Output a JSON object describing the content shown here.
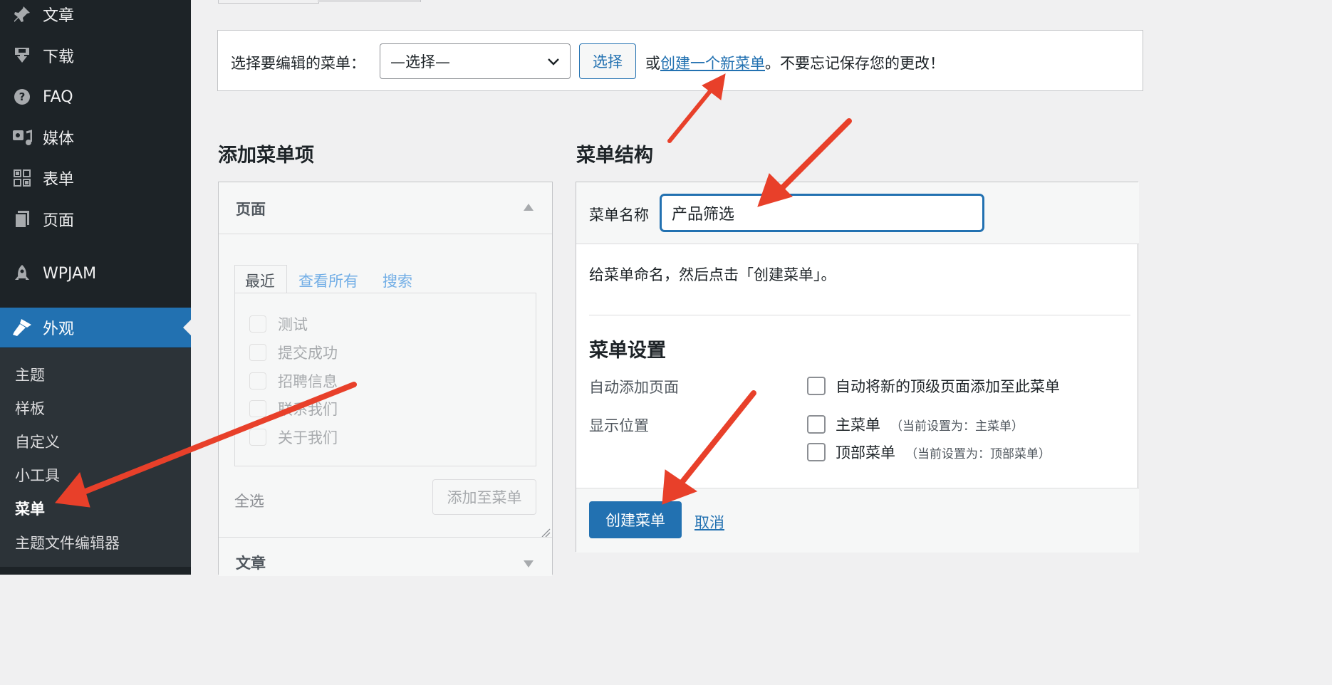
{
  "sidebar": {
    "items": [
      {
        "label": "文章",
        "icon": "pushpin-icon"
      },
      {
        "label": "下载",
        "icon": "download-icon"
      },
      {
        "label": "FAQ",
        "icon": "help-icon"
      },
      {
        "label": "媒体",
        "icon": "media-icon"
      },
      {
        "label": "表单",
        "icon": "forms-icon"
      },
      {
        "label": "页面",
        "icon": "pages-icon"
      },
      {
        "label": "WPJAM",
        "icon": "rocket-icon"
      },
      {
        "label": "外观",
        "icon": "appearance-icon"
      }
    ],
    "submenu": [
      "主题",
      "样板",
      "自定义",
      "小工具",
      "菜单",
      "主题文件编辑器"
    ]
  },
  "menu_select": {
    "label": "选择要编辑的菜单：",
    "selected": "—选择—",
    "button": "选择",
    "or": "或",
    "create_link": "创建一个新菜单",
    "reminder": "。不要忘记保存您的更改！"
  },
  "add_items": {
    "heading": "添加菜单项",
    "pages_title": "页面",
    "tabs": [
      "最近",
      "查看所有",
      "搜索"
    ],
    "pages": [
      "测试",
      "提交成功",
      "招聘信息",
      "联系我们",
      "关于我们"
    ],
    "select_all": "全选",
    "add_button": "添加至菜单",
    "posts_title": "文章"
  },
  "structure": {
    "heading": "菜单结构",
    "name_label": "菜单名称",
    "name_value": "产品筛选",
    "hint": "给菜单命名，然后点击「创建菜单」。",
    "settings_title": "菜单设置",
    "auto_add_label": "自动添加页面",
    "auto_add_option": "自动将新的顶级页面添加至此菜单",
    "location_label": "显示位置",
    "locations": [
      {
        "name": "主菜单",
        "note": "（当前设置为：主菜单）"
      },
      {
        "name": "顶部菜单",
        "note": "（当前设置为：顶部菜单）"
      }
    ],
    "create_button": "创建菜单",
    "cancel": "取消"
  },
  "colors": {
    "accent": "#2271b1",
    "sidebar": "#1d2327",
    "annotation": "#e8402a"
  }
}
